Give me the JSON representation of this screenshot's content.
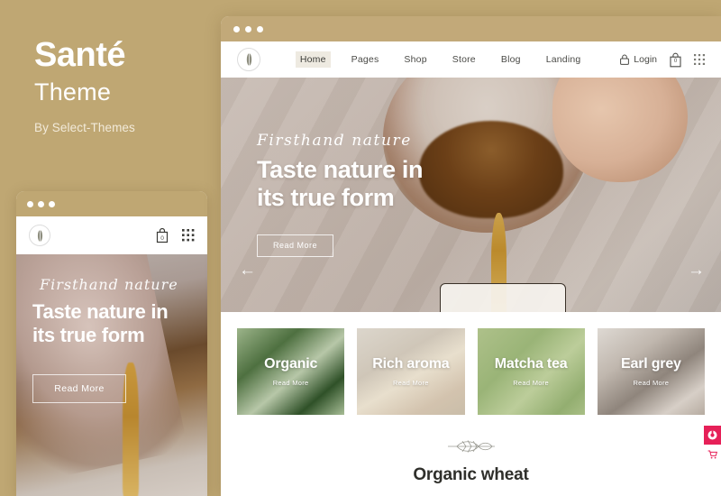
{
  "colors": {
    "background": "#bfa773",
    "titlebar": "#c2a979",
    "accent_pink": "#e62058",
    "nav_text": "#4a4a46",
    "nav_active_bg": "#eeeae1"
  },
  "promo": {
    "theme_name": "Santé",
    "theme_word": "Theme",
    "author": "By Select-Themes"
  },
  "window": {
    "dots": [
      "dot-1",
      "dot-2",
      "dot-3"
    ],
    "logo_icon": "wheat-logo-icon"
  },
  "nav": {
    "items": [
      {
        "label": "Home",
        "active": true
      },
      {
        "label": "Pages",
        "active": false
      },
      {
        "label": "Shop",
        "active": false
      },
      {
        "label": "Store",
        "active": false
      },
      {
        "label": "Blog",
        "active": false
      },
      {
        "label": "Landing",
        "active": false
      }
    ],
    "login_label": "Login",
    "login_icon": "lock-icon",
    "cart_icon": "shopping-bag-icon",
    "cart_count": "0",
    "grid_icon": "grid-dots-icon"
  },
  "hero": {
    "script_text": "Firsthand nature",
    "headline_line1": "Taste nature in",
    "headline_line2": "its true form",
    "button_label": "Read More",
    "arrow_prev": "←",
    "arrow_next": "→",
    "prev_icon": "arrow-left-icon",
    "next_icon": "arrow-right-icon"
  },
  "cards": [
    {
      "title": "Organic",
      "link": "Read More"
    },
    {
      "title": "Rich aroma",
      "link": "Read More"
    },
    {
      "title": "Matcha tea",
      "link": "Read More"
    },
    {
      "title": "Earl grey",
      "link": "Read More"
    }
  ],
  "bottom": {
    "ornament_icon": "wheat-leaf-ornament-icon",
    "title": "Organic wheat"
  },
  "mobile": {
    "logo_icon": "wheat-logo-icon",
    "cart_icon": "shopping-bag-icon",
    "cart_count": "0",
    "grid_icon": "grid-dots-icon",
    "script_text": "Firsthand nature",
    "headline_line1": "Taste nature in",
    "headline_line2": "its true form",
    "button_label": "Read More"
  },
  "side_buttons": [
    {
      "name": "envato-badge-button",
      "icon": "envato-circle-icon"
    },
    {
      "name": "cart-float-button",
      "icon": "cart-icon"
    }
  ]
}
